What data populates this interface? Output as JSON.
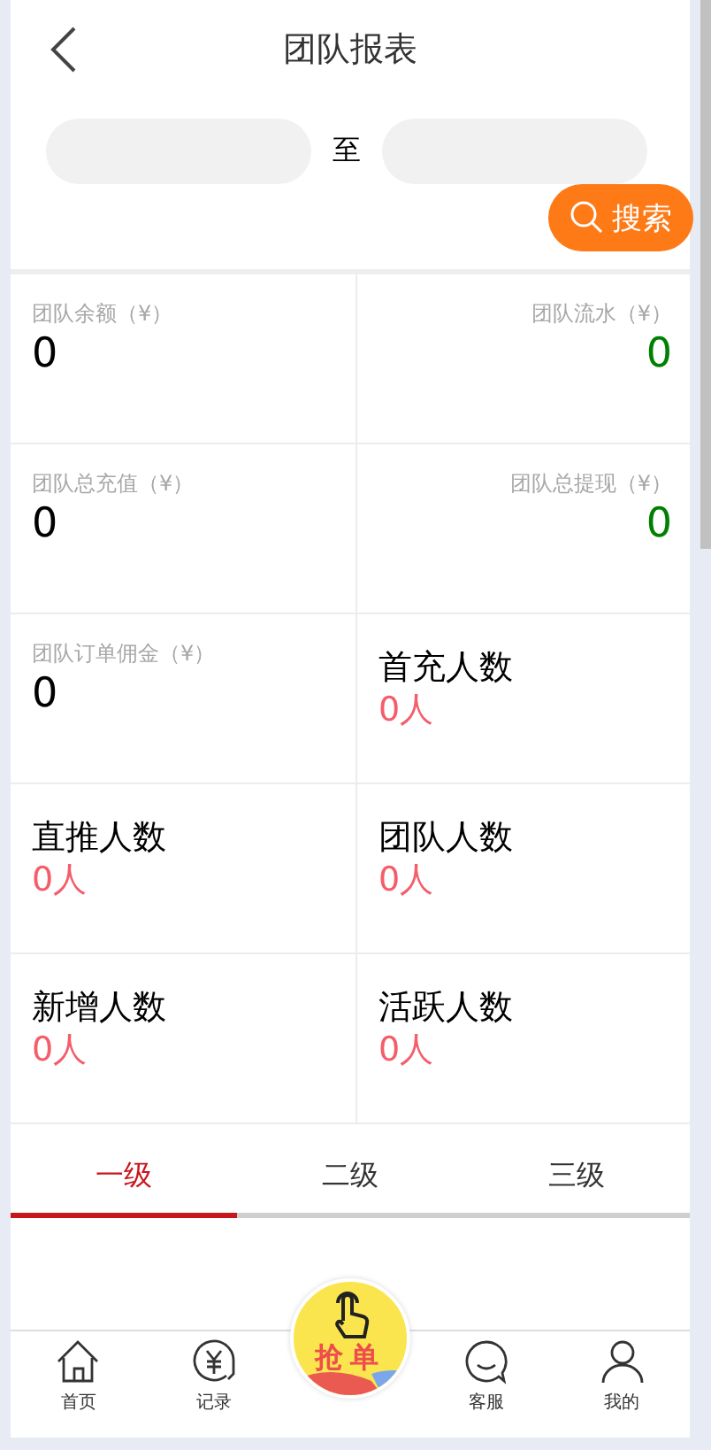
{
  "header": {
    "title": "团队报表"
  },
  "date_range": {
    "separator": "至"
  },
  "search_button": "搜索",
  "stats": [
    {
      "kind": "money",
      "label": "团队余额（¥）",
      "value": "0",
      "right_aligned": false,
      "color": "#000000"
    },
    {
      "kind": "money",
      "label": "团队流水（¥）",
      "value": "0",
      "right_aligned": true,
      "color": "#008000"
    },
    {
      "kind": "money",
      "label": "团队总充值（¥）",
      "value": "0",
      "right_aligned": false,
      "color": "#000000"
    },
    {
      "kind": "money",
      "label": "团队总提现（¥）",
      "value": "0",
      "right_aligned": true,
      "color": "#008000"
    },
    {
      "kind": "money",
      "label": "团队订单佣金（¥）",
      "value": "0",
      "right_aligned": false,
      "color": "#000000"
    },
    {
      "kind": "count",
      "label": "首充人数",
      "value": "0人"
    },
    {
      "kind": "count",
      "label": "直推人数",
      "value": "0人"
    },
    {
      "kind": "count",
      "label": "团队人数",
      "value": "0人"
    },
    {
      "kind": "count",
      "label": "新增人数",
      "value": "0人"
    },
    {
      "kind": "count",
      "label": "活跃人数",
      "value": "0人"
    }
  ],
  "tabs": [
    {
      "label": "一级",
      "selected": true
    },
    {
      "label": "二级",
      "selected": false
    },
    {
      "label": "三级",
      "selected": false
    }
  ],
  "bottom_nav": [
    {
      "kind": "home",
      "label": "首页"
    },
    {
      "kind": "records",
      "label": "记录"
    },
    {
      "kind": "grab",
      "label": "抢单"
    },
    {
      "kind": "service",
      "label": "客服"
    },
    {
      "kind": "profile",
      "label": "我的"
    }
  ]
}
